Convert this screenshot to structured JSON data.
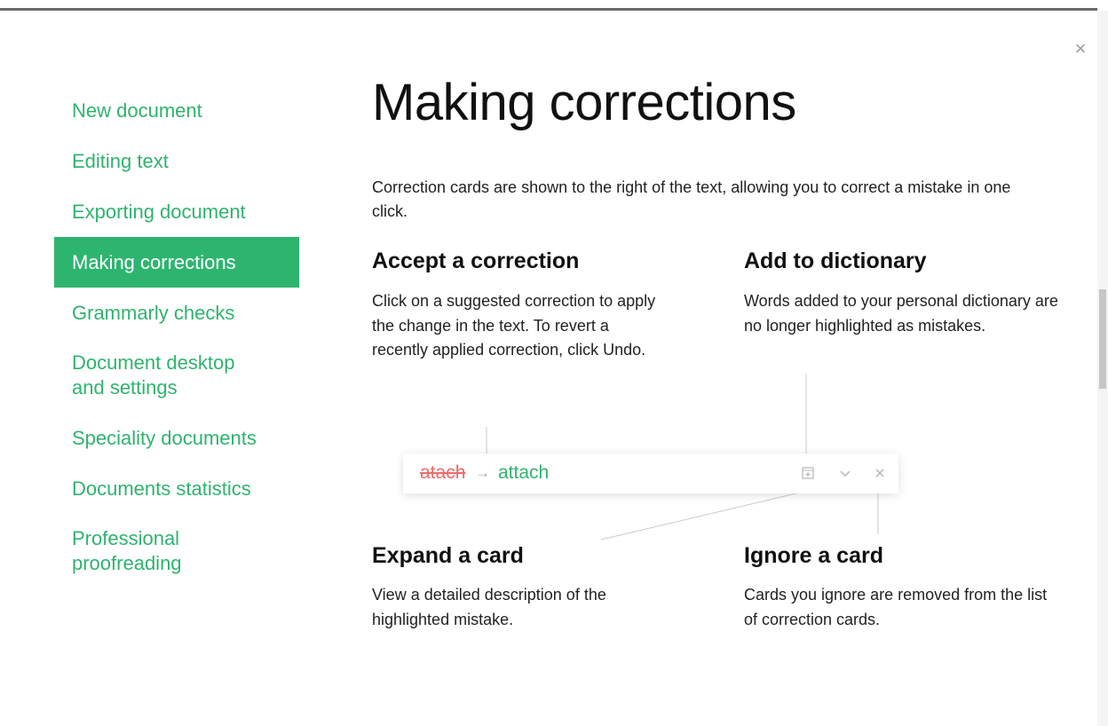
{
  "sidebar": {
    "items": [
      {
        "label": "New document"
      },
      {
        "label": "Editing text"
      },
      {
        "label": "Exporting document"
      },
      {
        "label": "Making corrections",
        "active": true
      },
      {
        "label": "Grammarly checks"
      },
      {
        "label": "Document desktop and settings"
      },
      {
        "label": "Speciality documents"
      },
      {
        "label": "Documents statistics"
      },
      {
        "label": "Professional proofreading"
      }
    ]
  },
  "main": {
    "title": "Making corrections",
    "intro": "Correction cards are shown to the right of the text, allowing you to correct a mistake in one click.",
    "sections": {
      "accept": {
        "title": "Accept a correction",
        "text": "Click on a suggested correction to apply the change in the text. To revert a recently applied correction, click Undo."
      },
      "dictionary": {
        "title": "Add to dictionary",
        "text": "Words added to your personal dictionary are no longer highlighted as mistakes."
      },
      "expand": {
        "title": "Expand a card",
        "text": "View a detailed description of the highlighted mistake."
      },
      "ignore": {
        "title": "Ignore a card",
        "text": "Cards you ignore are removed from the list of correction cards."
      }
    },
    "card": {
      "mistake": "atach",
      "arrow": "→",
      "correction": "attach",
      "icons": [
        "add-to-dictionary-icon",
        "expand-icon",
        "ignore-icon"
      ]
    }
  },
  "close_icon": "×",
  "colors": {
    "accent": "#2db56f",
    "link": "#2fb36e",
    "mistake": "#ea6b6b"
  }
}
